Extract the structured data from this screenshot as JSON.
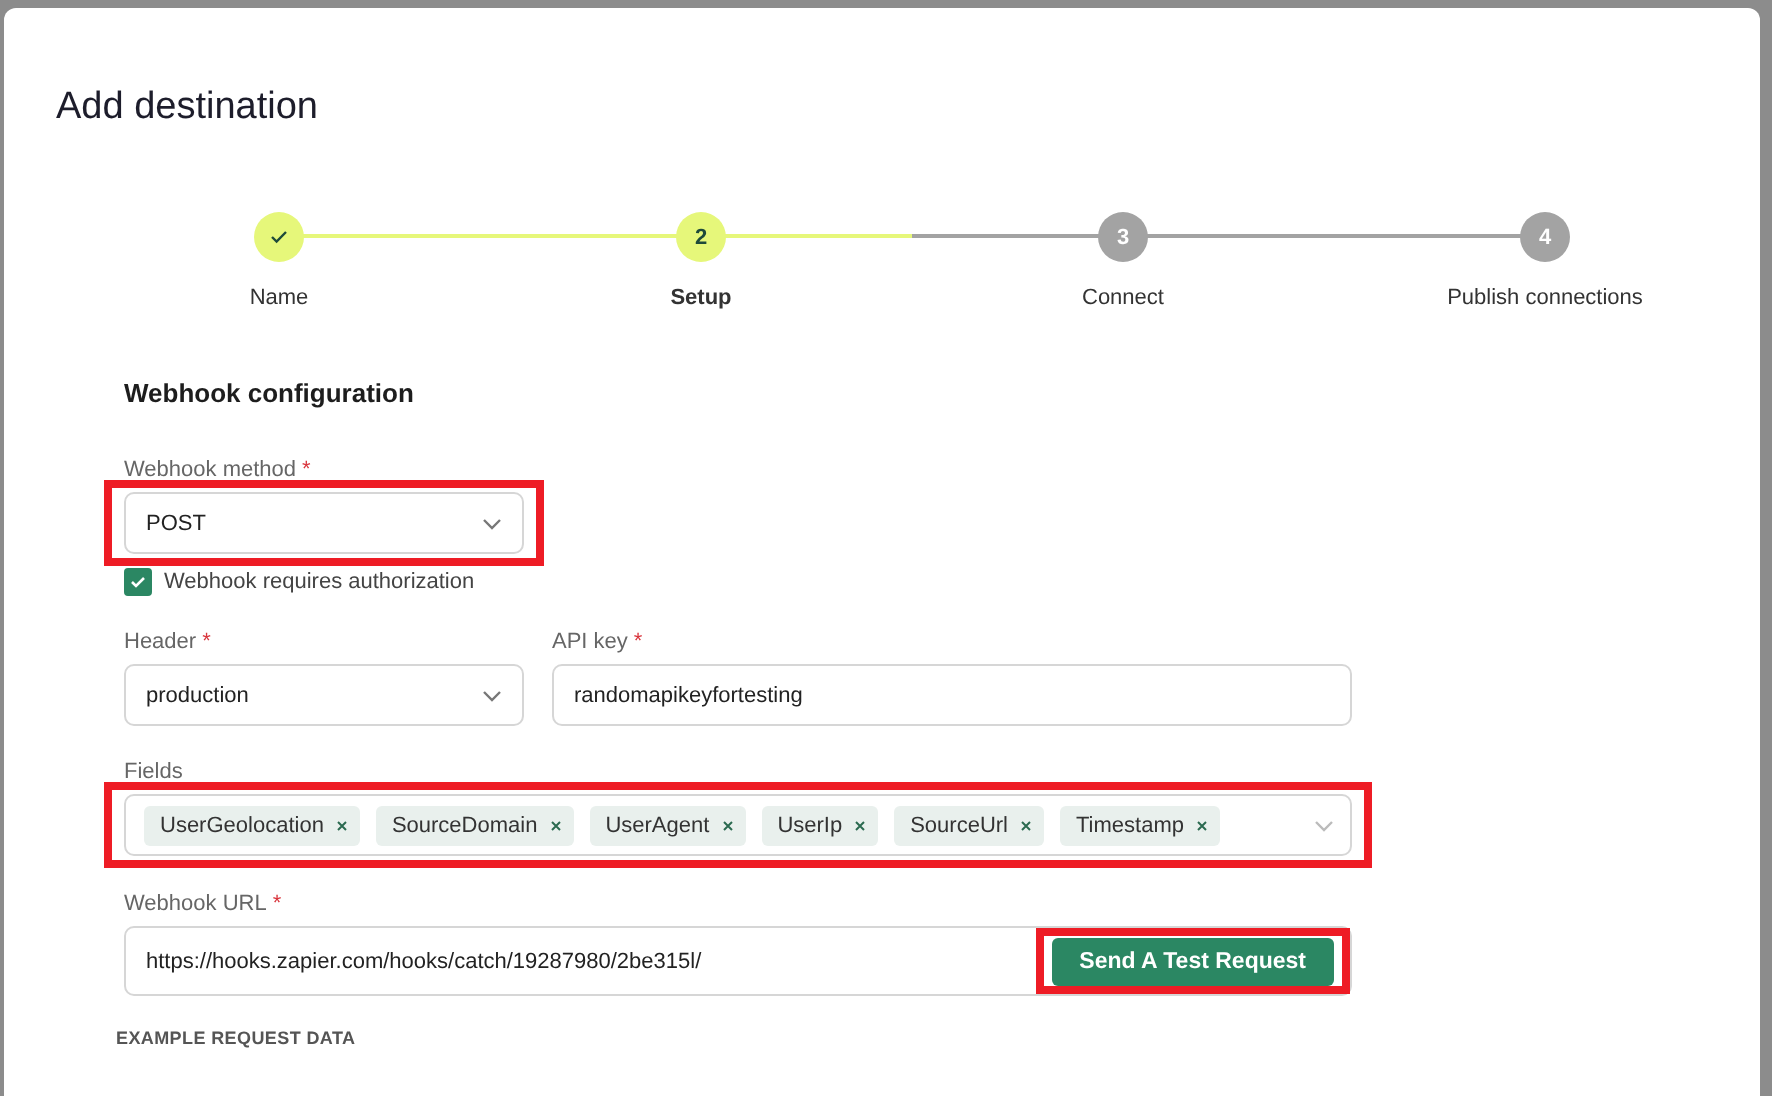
{
  "dialog": {
    "title": "Add destination"
  },
  "steps": [
    {
      "label": "Name",
      "completed": true,
      "selected": false
    },
    {
      "label": "Setup",
      "number": "2",
      "completed": false,
      "selected": true
    },
    {
      "label": "Connect",
      "number": "3",
      "completed": false,
      "selected": false
    },
    {
      "label": "Publish connections",
      "number": "4",
      "completed": false,
      "selected": false
    }
  ],
  "section_title": "Webhook configuration",
  "method": {
    "label": "Webhook method",
    "required_mark": "*",
    "value": "POST",
    "highlighted": true
  },
  "authorization": {
    "label": "Webhook requires authorization",
    "checked": true
  },
  "header": {
    "label": "Header",
    "required_mark": "*",
    "value": "production"
  },
  "api_key": {
    "label": "API key",
    "required_mark": "*",
    "value": "randomapikeyfortesting"
  },
  "fields": {
    "label": "Fields",
    "highlighted": true,
    "tags": [
      "UserGeolocation",
      "SourceDomain",
      "UserAgent",
      "UserIp",
      "SourceUrl",
      "Timestamp"
    ]
  },
  "webhook_url": {
    "label": "Webhook URL",
    "required_mark": "*",
    "value": "https://hooks.zapier.com/hooks/catch/19287980/2be315l/",
    "button": "Send A Test Request",
    "button_highlighted": true
  },
  "example_heading": "EXAMPLE REQUEST DATA"
}
